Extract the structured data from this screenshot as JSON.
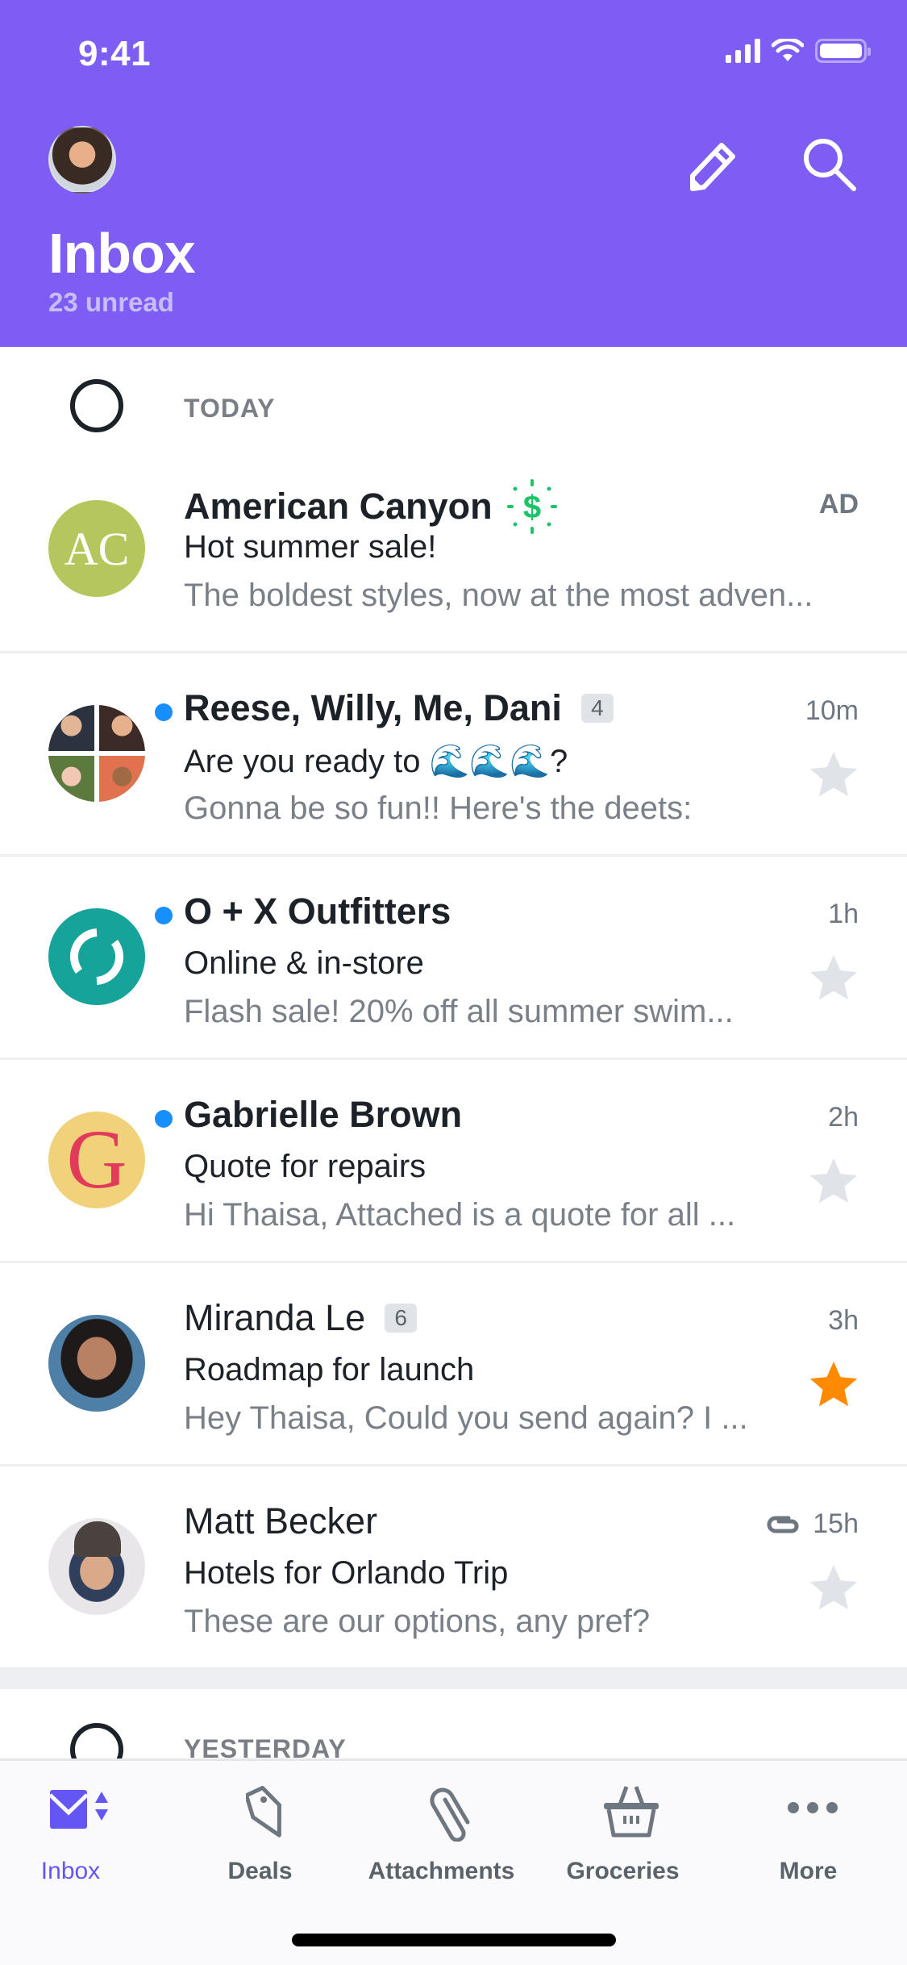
{
  "status_bar": {
    "time": "9:41"
  },
  "header": {
    "title": "Inbox",
    "subtitle": "23 unread",
    "bg_color": "#7e5df4",
    "icons": [
      "compose-icon",
      "search-icon"
    ]
  },
  "sections": [
    {
      "label": "TODAY"
    },
    {
      "label": "YESTERDAY"
    }
  ],
  "emails": [
    {
      "sender": "American Canyon",
      "avatar_initials": "AC",
      "avatar_color": "#b5c75c",
      "subject": "Hot summer sale!",
      "snippet": "The boldest styles, now at the most adven...",
      "time": "AD",
      "unread": false,
      "bold": true,
      "sponsored_icon": "dollar-deal-icon",
      "starred": null
    },
    {
      "sender": "Reese, Willy, Me, Dani",
      "count": "4",
      "subject": "Are you ready to 🌊🌊🌊?",
      "snippet": "Gonna be so fun!! Here's the deets:",
      "time": "10m",
      "unread": true,
      "bold": true,
      "starred": false
    },
    {
      "sender": "O + X Outfitters",
      "avatar_color": "#16a39a",
      "subject": "Online & in-store",
      "snippet": "Flash sale! 20% off all summer swim...",
      "time": "1h",
      "unread": true,
      "bold": true,
      "starred": false
    },
    {
      "sender": "Gabrielle Brown",
      "avatar_initials": "G",
      "avatar_color": "#f1d27a",
      "subject": "Quote for repairs",
      "snippet": "Hi Thaisa, Attached is a quote for all ...",
      "time": "2h",
      "unread": true,
      "bold": true,
      "starred": false
    },
    {
      "sender": "Miranda Le",
      "count": "6",
      "subject": "Roadmap for launch",
      "snippet": "Hey Thaisa, Could you send again? I ...",
      "time": "3h",
      "unread": false,
      "bold": false,
      "starred": true
    },
    {
      "sender": "Matt Becker",
      "subject": "Hotels for Orlando Trip",
      "snippet": "These are our options, any pref?",
      "time": "15h",
      "has_attachment": true,
      "unread": false,
      "bold": false,
      "starred": false
    }
  ],
  "tabbar": {
    "tabs": [
      {
        "label": "Inbox",
        "icon": "inbox-envelope-icon",
        "active": true
      },
      {
        "label": "Deals",
        "icon": "tag-icon",
        "active": false
      },
      {
        "label": "Attachments",
        "icon": "paperclip-icon",
        "active": false
      },
      {
        "label": "Groceries",
        "icon": "basket-icon",
        "active": false
      },
      {
        "label": "More",
        "icon": "more-dots-icon",
        "active": false
      }
    ]
  },
  "colors": {
    "accent": "#6456f2",
    "unread_dot": "#188fff",
    "star_active": "#ff8a00",
    "star_inactive": "#e0e4e9",
    "deal_green": "#1ac567"
  }
}
